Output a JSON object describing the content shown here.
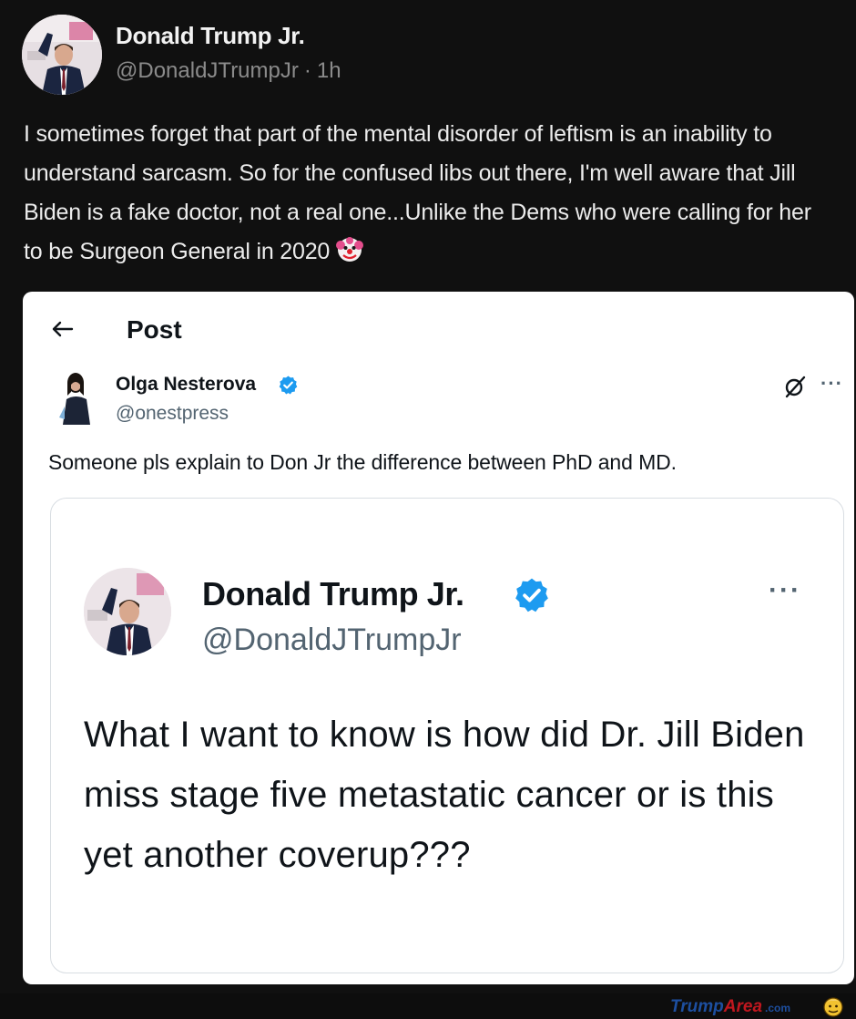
{
  "post": {
    "author_name": "Donald Trump Jr.",
    "author_handle": "@DonaldJTrumpJr",
    "separator": "·",
    "time": "1h",
    "text": "I sometimes forget that part of the mental disorder of leftism is an inability to understand sarcasm. So for the confused libs out there, I'm well aware that Jill Biden is a fake doctor, not a real one...Unlike the Dems who were calling for her to be Surgeon General in 2020",
    "emoji": "clown-face-icon"
  },
  "screenshot": {
    "header_title": "Post",
    "reply": {
      "author_name": "Olga Nesterova",
      "author_handle": "@onestpress",
      "text": "Someone pls explain to Don Jr the difference between PhD and MD.",
      "more": "···"
    },
    "quoted": {
      "author_name": "Donald Trump Jr.",
      "author_handle": "@DonaldJTrumpJr",
      "more": "···",
      "text": "What I want to know is how did Dr. Jill Biden miss stage five metastatic cancer or is this yet another coverup???"
    }
  },
  "watermark": {
    "part1": "Trump",
    "part2": "Area",
    "suffix": ".com"
  },
  "colors": {
    "background": "#101010",
    "verified_blue": "#1d9bf0",
    "watermark_blue": "#1d4fa0",
    "watermark_red": "#c0171f"
  }
}
